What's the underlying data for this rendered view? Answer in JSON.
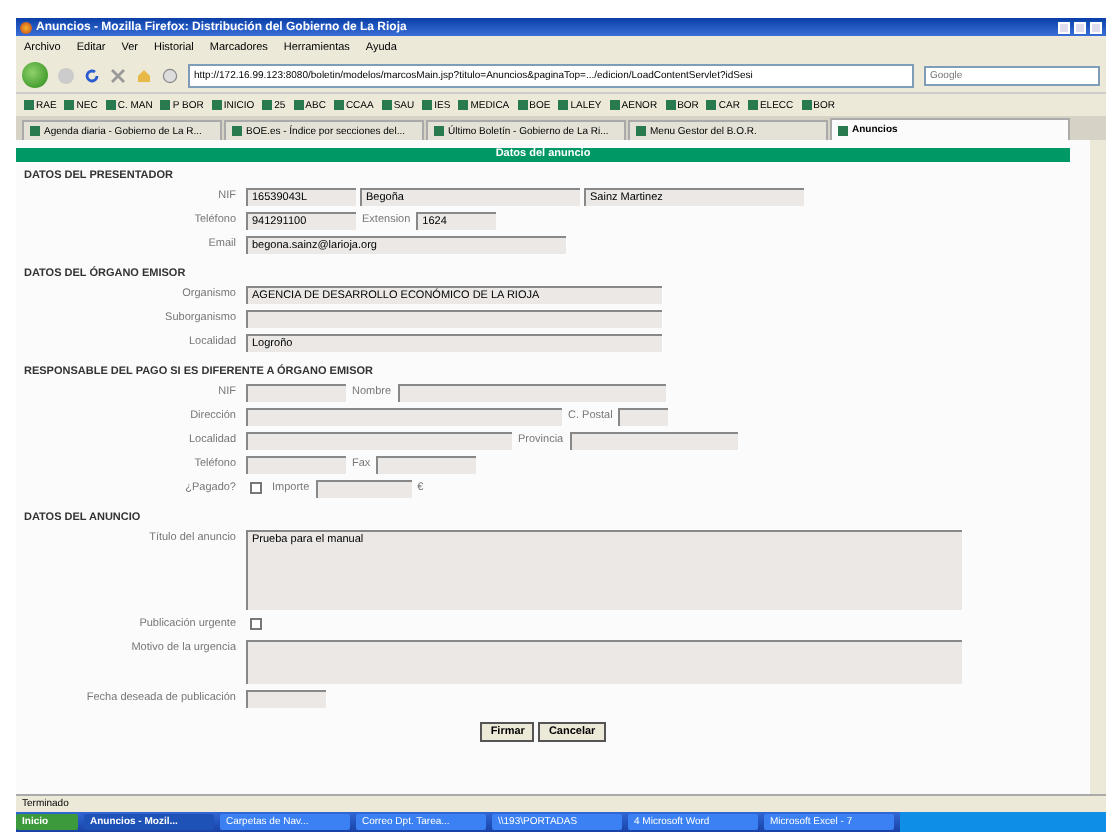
{
  "window": {
    "title": "Anuncios - Mozilla Firefox: Distribución del Gobierno de La Rioja"
  },
  "menu": [
    "Archivo",
    "Editar",
    "Ver",
    "Historial",
    "Marcadores",
    "Herramientas",
    "Ayuda"
  ],
  "address_bar": {
    "value": "http://172.16.99.123:8080/boletin/modelos/marcosMain.jsp?titulo=Anuncios&paginaTop=.../edicion/LoadContentServlet?idSesi"
  },
  "search": {
    "placeholder": "Google"
  },
  "bookmarks": [
    "RAE",
    "NEC",
    "C. MAN",
    "P BOR",
    "INICIO",
    "25",
    "ABC",
    "CCAA",
    "SAU",
    "IES",
    "MEDICA",
    "BOE",
    "LALEY",
    "AENOR",
    "BOR",
    "CAR",
    "ELECC",
    "BOR"
  ],
  "tabs": [
    {
      "label": "Agenda diaria - Gobierno de La R...",
      "selected": false
    },
    {
      "label": "BOE.es - Índice por secciones del...",
      "selected": false
    },
    {
      "label": "Último Boletín - Gobierno de La Ri...",
      "selected": false
    },
    {
      "label": "Menu Gestor del B.O.R.",
      "selected": false
    },
    {
      "label": "Anuncios",
      "selected": true
    }
  ],
  "form": {
    "header": "Datos del anuncio",
    "sections": [
      {
        "title": "DATOS DEL PRESENTADOR",
        "rows": [
          {
            "label": "NIF",
            "items": [
              {
                "kind": "field",
                "value": "16539043L"
              },
              {
                "kind": "field",
                "value": "Begoña"
              },
              {
                "kind": "field",
                "value": "Sainz Martinez"
              }
            ]
          },
          {
            "label": "Teléfono",
            "items": [
              {
                "kind": "field",
                "value": "941291100"
              },
              {
                "kind": "label",
                "text": "Extension"
              },
              {
                "kind": "field",
                "value": "1624"
              }
            ]
          },
          {
            "label": "Email",
            "items": [
              {
                "kind": "field",
                "value": "begona.sainz@larioja.org"
              }
            ]
          }
        ]
      },
      {
        "title": "DATOS DEL ÓRGANO EMISOR",
        "rows": [
          {
            "label": "Organismo",
            "items": [
              {
                "kind": "field",
                "value": "AGENCIA DE DESARROLLO ECONÓMICO DE LA RIOJA"
              }
            ]
          },
          {
            "label": "Suborganismo",
            "items": [
              {
                "kind": "field"
              }
            ]
          },
          {
            "label": "Localidad",
            "items": [
              {
                "kind": "field",
                "value": "Logroño"
              }
            ]
          }
        ]
      },
      {
        "title": "RESPONSABLE DEL PAGO SI ES DIFERENTE A ÓRGANO EMISOR",
        "rows": [
          {
            "label": "NIF",
            "items": [
              {
                "kind": "field"
              },
              {
                "kind": "label",
                "text": "Nombre"
              },
              {
                "kind": "field"
              }
            ]
          },
          {
            "label": "Dirección",
            "items": [
              {
                "kind": "field"
              },
              {
                "kind": "label",
                "text": "C. Postal"
              },
              {
                "kind": "field"
              }
            ]
          },
          {
            "label": "Localidad",
            "items": [
              {
                "kind": "field"
              },
              {
                "kind": "label",
                "text": "Provincia"
              },
              {
                "kind": "field"
              }
            ]
          },
          {
            "label": "Teléfono",
            "items": [
              {
                "kind": "field"
              },
              {
                "kind": "label",
                "text": "Fax"
              },
              {
                "kind": "field"
              }
            ]
          },
          {
            "label": "¿Pagado?",
            "items": [
              {
                "kind": "checkbox",
                "checked": false
              },
              {
                "kind": "label",
                "text": "Importe"
              },
              {
                "kind": "field"
              },
              {
                "kind": "label",
                "text": "€"
              }
            ]
          }
        ]
      },
      {
        "title": "DATOS DEL ANUNCIO",
        "rows": [
          {
            "label": "Título del anuncio",
            "items": [
              {
                "kind": "area",
                "value": "Prueba para el manual"
              }
            ]
          },
          {
            "label": "Publicación urgente",
            "items": [
              {
                "kind": "checkbox",
                "checked": false
              }
            ]
          },
          {
            "label": "Motivo de la urgencia",
            "items": [
              {
                "kind": "area"
              }
            ]
          },
          {
            "label": "Fecha deseada de publicación",
            "items": [
              {
                "kind": "field"
              }
            ]
          }
        ]
      }
    ],
    "buttons": [
      "Firmar",
      "Cancelar"
    ]
  },
  "status_bar": "Terminado",
  "start_button": "Inicio",
  "taskbar": [
    {
      "label": "Anuncios - Mozil...",
      "selected": true
    },
    {
      "label": "Carpetas de Nav...",
      "selected": false
    },
    {
      "label": "Correo Dpt. Tarea...",
      "selected": false
    },
    {
      "label": "\\\\193\\PORTADAS",
      "selected": false
    },
    {
      "label": "4 Microsoft Word",
      "selected": false
    },
    {
      "label": "Microsoft Excel - 7",
      "selected": false
    }
  ]
}
